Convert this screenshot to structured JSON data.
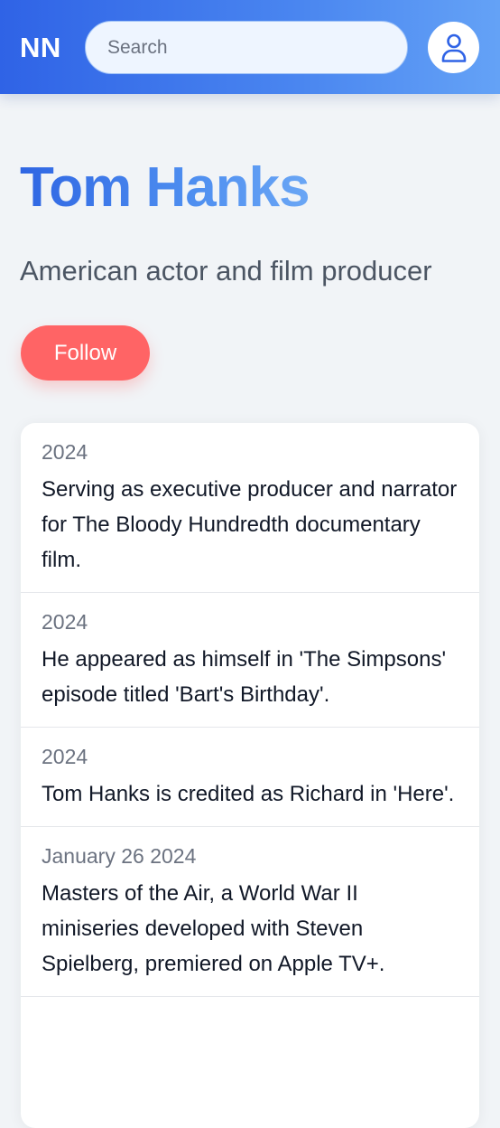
{
  "header": {
    "logo": "NN",
    "search_placeholder": "Search",
    "profile_icon": "user-icon"
  },
  "profile": {
    "name": "Tom Hanks",
    "description": "American actor and film producer",
    "follow_label": "Follow"
  },
  "timeline": [
    {
      "date": "2024",
      "text": "Serving as executive producer and narrator for The Bloody Hundredth documentary film."
    },
    {
      "date": "2024",
      "text": "He appeared as himself in 'The Simpsons' episode titled 'Bart's Birthday'."
    },
    {
      "date": "2024",
      "text": "Tom Hanks is credited as Richard in 'Here'."
    },
    {
      "date": "January 26 2024",
      "text": "Masters of the Air, a World War II miniseries developed with Steven Spielberg, premiered on Apple TV+."
    }
  ],
  "colors": {
    "header_gradient_start": "#2f63e6",
    "header_gradient_end": "#64a2f6",
    "follow_button": "#ff6465",
    "page_background": "#f1f4f7"
  }
}
